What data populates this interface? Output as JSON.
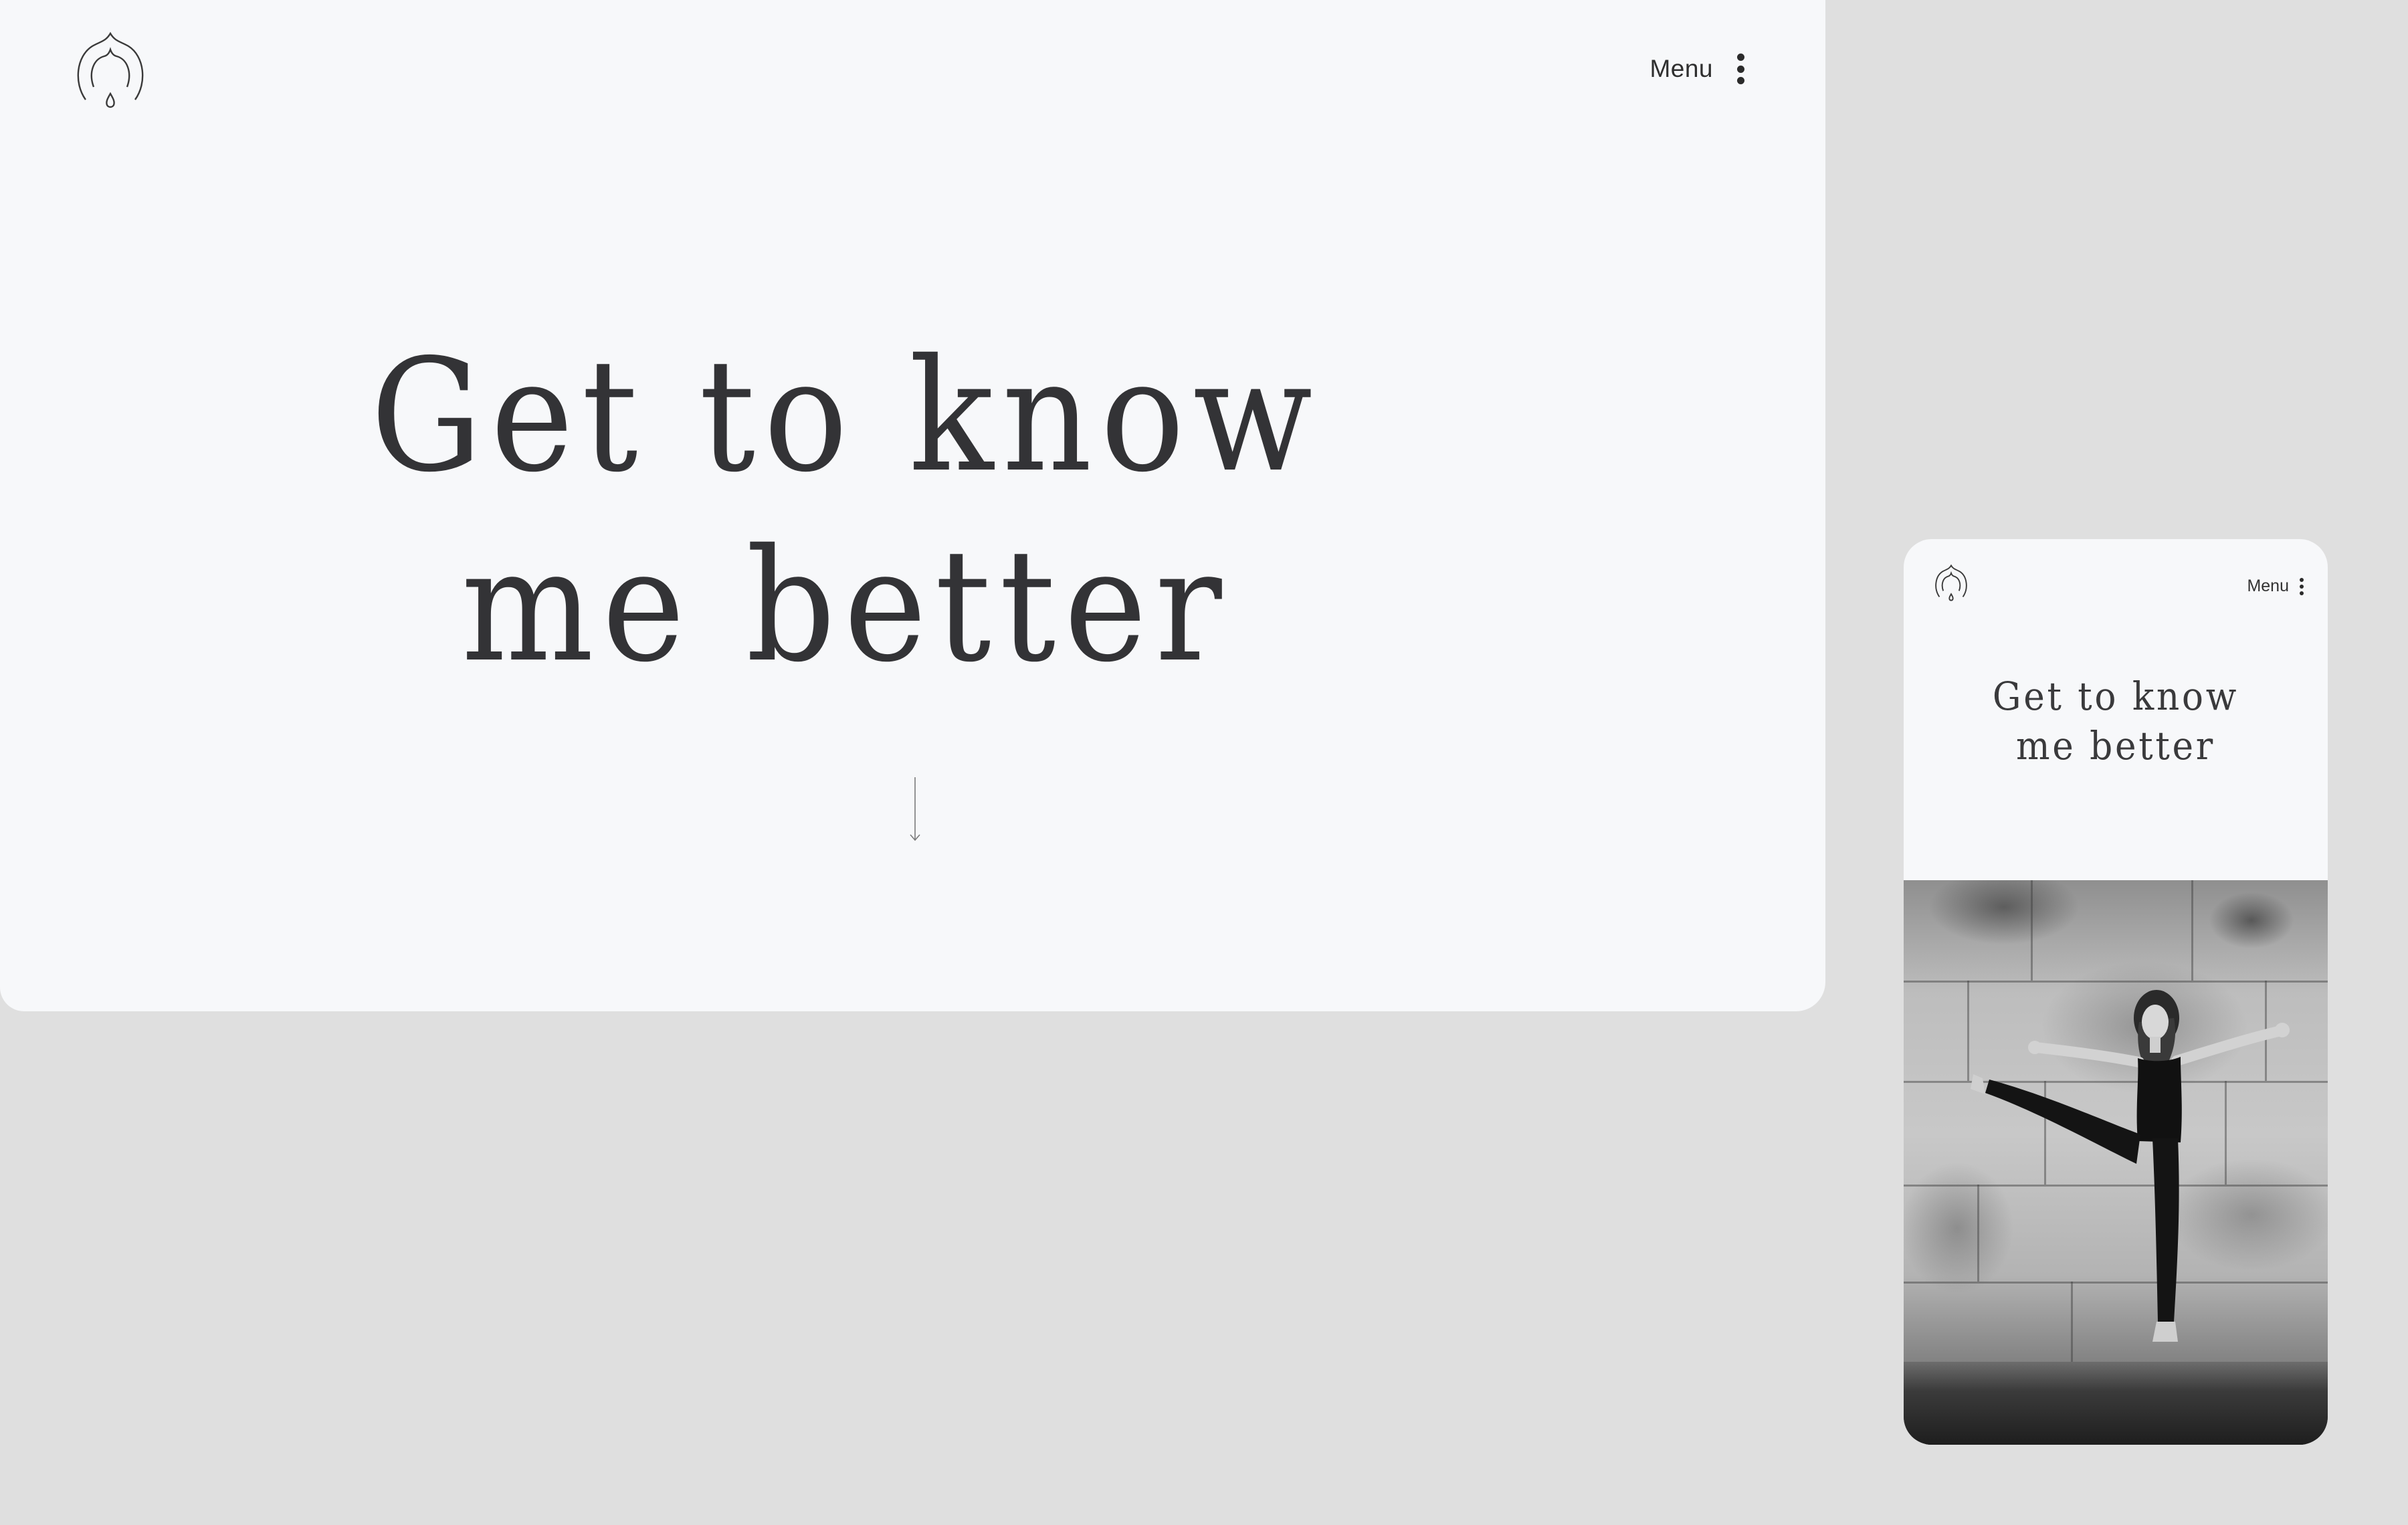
{
  "desktop": {
    "logo": {
      "icon": "lotus-drop-icon"
    },
    "menu": {
      "label": "Menu",
      "icon": "vertical-dots-icon"
    },
    "headline": {
      "line1": "Get to know",
      "line2": "me better"
    },
    "scroll": {
      "icon": "down-arrow-icon"
    }
  },
  "mobile": {
    "logo": {
      "icon": "lotus-drop-icon"
    },
    "menu": {
      "label": "Menu",
      "icon": "vertical-dots-icon"
    },
    "headline": {
      "line1": "Get to know",
      "line2": "me better"
    },
    "photo": {
      "style": "black-and-white"
    }
  },
  "colors": {
    "page_background": "#dfdfdf",
    "card_background": "#f7f8fa",
    "text": "#333336"
  }
}
